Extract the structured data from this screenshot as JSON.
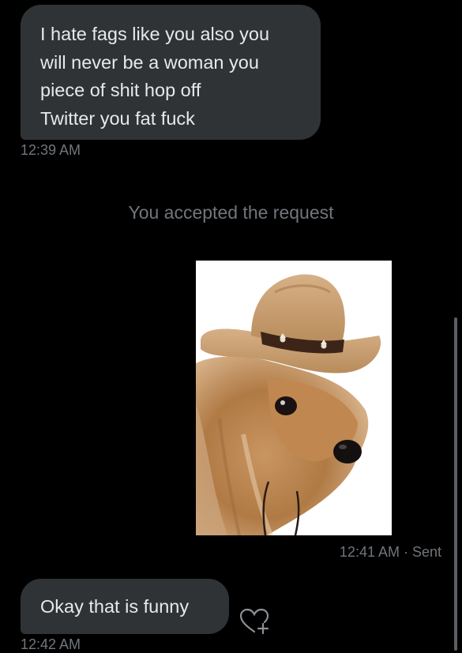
{
  "conversation": {
    "received_message": {
      "lines": [
        "I hate fags like you also you",
        "will never be a woman you",
        "piece of shit hop off",
        "Twitter you fat fuck"
      ],
      "timestamp": "12:39 AM"
    },
    "system_notice": "You accepted the request",
    "sent_image": {
      "icon": "dog-in-cowboy-hat-photo",
      "timestamp": "12:41 AM · Sent"
    },
    "reply_message": {
      "text": "Okay that is funny",
      "timestamp": "12:42 AM"
    },
    "reaction_button": {
      "icon": "heart-plus-icon"
    }
  },
  "colors": {
    "background": "#000000",
    "bubble": "#2f3336",
    "text_primary": "#e7e9ea",
    "text_secondary": "#71767b"
  }
}
